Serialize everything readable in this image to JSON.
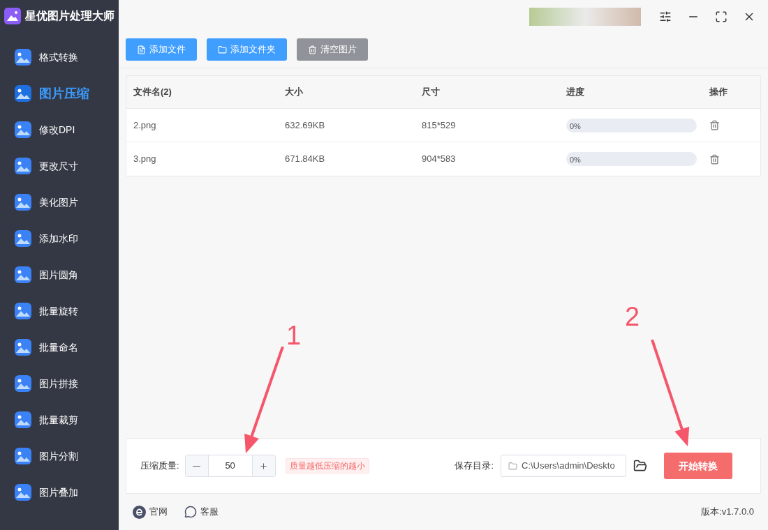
{
  "app": {
    "title": "星优图片处理大师"
  },
  "sidebar": {
    "items": [
      {
        "label": "格式转换",
        "selected": false
      },
      {
        "label": "图片压缩",
        "selected": true
      },
      {
        "label": "修改DPI",
        "selected": false
      },
      {
        "label": "更改尺寸",
        "selected": false
      },
      {
        "label": "美化图片",
        "selected": false
      },
      {
        "label": "添加水印",
        "selected": false
      },
      {
        "label": "图片圆角",
        "selected": false
      },
      {
        "label": "批量旋转",
        "selected": false
      },
      {
        "label": "批量命名",
        "selected": false
      },
      {
        "label": "图片拼接",
        "selected": false
      },
      {
        "label": "批量裁剪",
        "selected": false
      },
      {
        "label": "图片分割",
        "selected": false
      },
      {
        "label": "图片叠加",
        "selected": false
      }
    ]
  },
  "toolbar": [
    {
      "label": "添加文件",
      "kind": "file"
    },
    {
      "label": "添加文件夹",
      "kind": "folder"
    },
    {
      "label": "清空图片",
      "kind": "clear"
    }
  ],
  "table": {
    "columns": [
      "文件名(2)",
      "大小",
      "尺寸",
      "进度",
      "操作"
    ],
    "rows": [
      {
        "name": "2.png",
        "size": "632.69KB",
        "dimensions": "815*529",
        "progress": {
          "level": 0,
          "reading": "0%"
        }
      },
      {
        "name": "3.png",
        "size": "671.84KB",
        "dimensions": "904*583",
        "progress": {
          "level": 0,
          "reading": "0%"
        }
      }
    ]
  },
  "settings": {
    "quality_label": "压缩质量:",
    "quality_value": "50",
    "quality_hint": "质量越低压缩的越小",
    "save_label": "保存目录:",
    "save_path": "C:\\Users\\admin\\Deskto",
    "start_button": "开始转换"
  },
  "footer": {
    "links": [
      "官网",
      "客服"
    ],
    "version": "版本:v1.7.0.0"
  },
  "annotations": [
    {
      "label": "1"
    },
    {
      "label": "2"
    }
  ]
}
